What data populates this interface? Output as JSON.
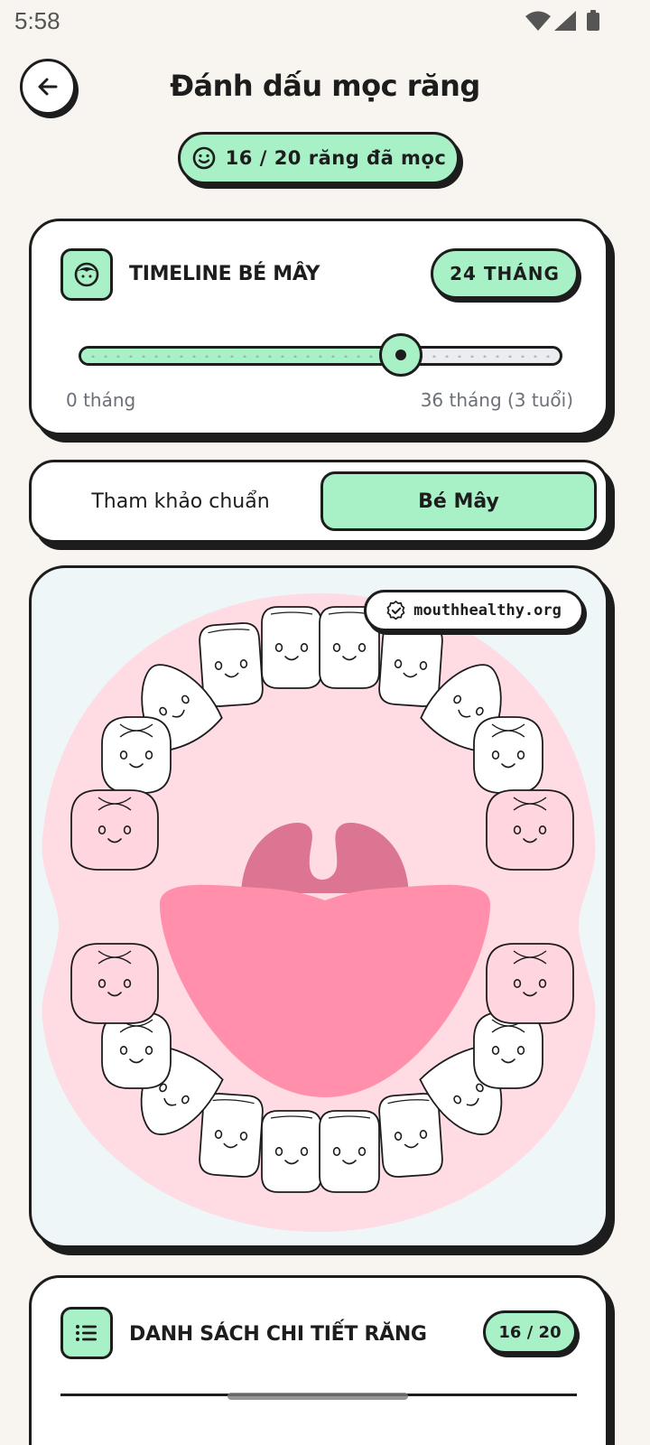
{
  "status_bar": {
    "time": "5:58"
  },
  "header": {
    "title": "Đánh dấu mọc răng"
  },
  "summary": {
    "erupted_label": "16 / 20 răng đã mọc"
  },
  "timeline": {
    "title": "TIMELINE BÉ MÂY",
    "age_badge": "24 THÁNG",
    "min_label": "0 tháng",
    "max_label": "36 tháng (3 tuổi)",
    "value_months": 24,
    "max_months": 36
  },
  "view_toggle": {
    "reference_label": "Tham khảo chuẩn",
    "baby_label": "Bé Mây",
    "selected": "baby"
  },
  "mouth_chart": {
    "source": "mouthhealthy.org",
    "upper_teeth": [
      "erupted",
      "erupted",
      "erupted",
      "erupted",
      "erupted",
      "erupted",
      "erupted",
      "erupted",
      "not-erupted",
      "not-erupted"
    ],
    "lower_teeth": [
      "erupted",
      "erupted",
      "erupted",
      "erupted",
      "erupted",
      "erupted",
      "erupted",
      "erupted",
      "not-erupted",
      "not-erupted"
    ],
    "colors": {
      "erupted": "#ffffff",
      "not_erupted": "#ffd5e0",
      "gum": "#ffdbe4",
      "tongue": "#ff8fab",
      "palate": "#dc7591",
      "accent": "#a8f0c6"
    }
  },
  "detail_list": {
    "title": "DANH SÁCH CHI TIẾT RĂNG",
    "count_badge": "16 / 20"
  }
}
